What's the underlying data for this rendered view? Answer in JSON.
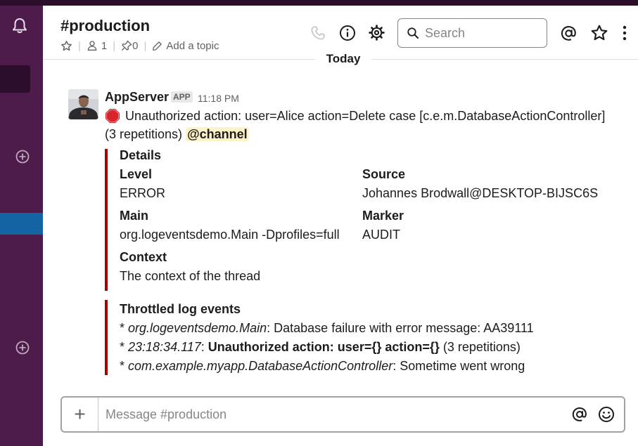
{
  "channel": {
    "name": "#production",
    "members": "1",
    "pins": "0",
    "add_topic": "Add a topic"
  },
  "search": {
    "placeholder": "Search"
  },
  "divider": {
    "label": "Today"
  },
  "message": {
    "author": "AppServer",
    "badge": "APP",
    "time": "11:18 PM",
    "text_line1": "Unauthorized action: user=Alice action=Delete case [c.e.m.DatabaseActionController]",
    "text_line2": "(3 repetitions)",
    "mention": "@channel"
  },
  "details": {
    "title": "Details",
    "level_label": "Level",
    "level_value": "ERROR",
    "source_label": "Source",
    "source_value": "Johannes Brodwall@DESKTOP-BIJSC6S",
    "main_label": "Main",
    "main_value": "org.logeventsdemo.Main -Dprofiles=full",
    "marker_label": "Marker",
    "marker_value": "AUDIT",
    "context_label": "Context",
    "context_value": "The context of the thread"
  },
  "throttled": {
    "title": "Throttled log events",
    "events": [
      {
        "bullet": "* ",
        "source": "org.logeventsdemo.Main",
        "message": ": Database failure with error message: AA39111"
      },
      {
        "bullet": "* ",
        "source": "23:18:34.117",
        "sep": ": ",
        "message": "Unauthorized action: user={} action={}",
        "suffix": " (3 repetitions)"
      },
      {
        "bullet": "* ",
        "source": "com.example.myapp.DatabaseActionController",
        "message": ": Sometime went wrong"
      }
    ]
  },
  "composer": {
    "placeholder": "Message #production",
    "plus": "+"
  },
  "icons": {
    "bell": "bell-icon",
    "add": "add-circle-icon",
    "phone": "phone-icon",
    "info": "info-icon",
    "settings": "gear-icon",
    "search": "search-icon",
    "mentions": "at-icon",
    "starred": "star-icon",
    "more": "more-vertical-icon",
    "emoji": "emoji-icon",
    "stop": "stop-sign-icon"
  },
  "colors": {
    "sidebar": "#4d1c4b",
    "sidebar_dark": "#2c0e2a",
    "active_item": "#1264a3",
    "attachment_bar": "#a30200",
    "mention_highlight": "#fdf2c8"
  }
}
